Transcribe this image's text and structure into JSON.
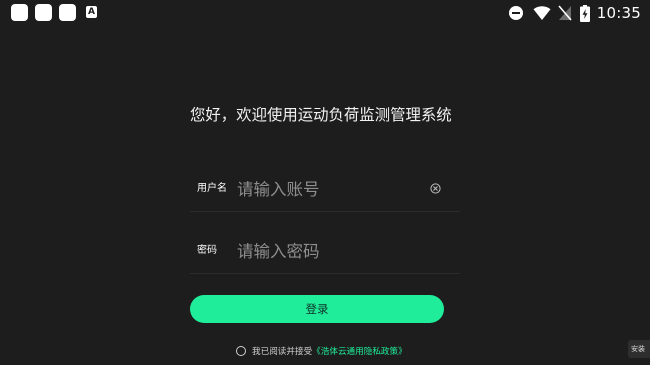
{
  "status_bar": {
    "time": "10:35",
    "left_icons": [
      "app-square-icon",
      "app-square-icon",
      "app-square-icon",
      "a-badge-icon"
    ],
    "right_icons": [
      "do-not-disturb-icon",
      "wifi-icon",
      "no-sim-icon",
      "battery-charging-icon"
    ],
    "badge_letter": "A"
  },
  "login": {
    "title": "您好，欢迎使用运动负荷监测管理系统",
    "username_label": "用户名",
    "username_placeholder": "请输入账号",
    "password_label": "密码",
    "password_placeholder": "请输入密码",
    "login_button": "登录",
    "agreement_text": "我已阅读并接受",
    "agreement_link": "《浩体云通用隐私政策》"
  },
  "corner_tab": {
    "label": "安装"
  },
  "colors": {
    "background": "#1d1d1d",
    "accent": "#1fed9a",
    "placeholder": "#8e8e8e",
    "divider": "#2c2c2c"
  }
}
